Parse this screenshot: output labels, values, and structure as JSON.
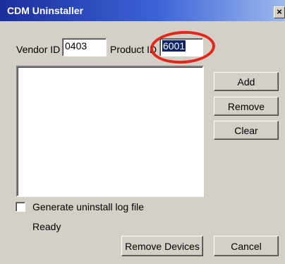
{
  "window": {
    "title": "CDM Uninstaller",
    "close_glyph": "×"
  },
  "fields": {
    "vendor_label": "Vendor ID",
    "vendor_value": "0403",
    "product_label": "Product ID",
    "product_value": "6001"
  },
  "buttons": {
    "add": "Add",
    "remove": "Remove",
    "clear": "Clear",
    "remove_devices": "Remove Devices",
    "cancel": "Cancel"
  },
  "options": {
    "log_label": "Generate uninstall log file",
    "log_checked": false
  },
  "status": "Ready",
  "colors": {
    "annotation_ring": "#e32619",
    "selection": "#0a246a"
  }
}
